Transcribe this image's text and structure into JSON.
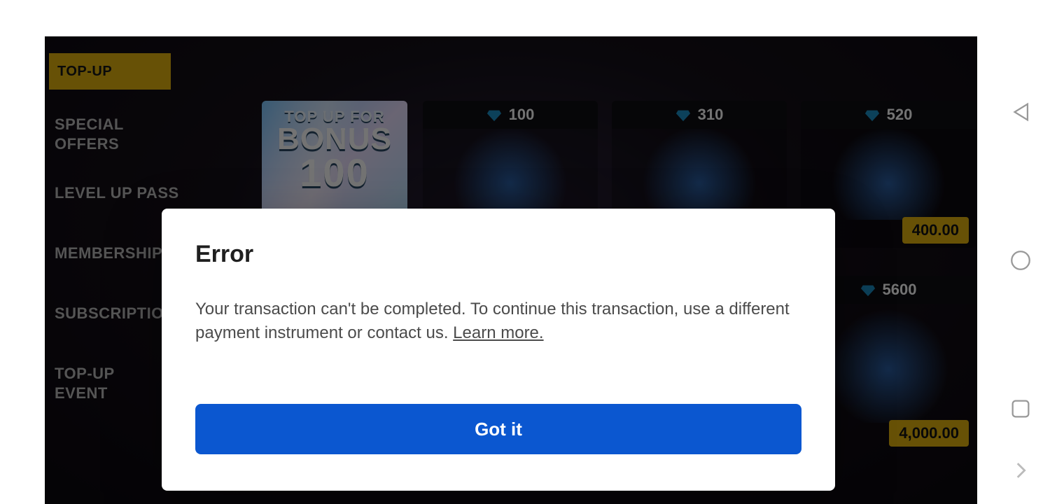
{
  "sidebar": {
    "active_tab": "TOP-UP",
    "items": [
      {
        "label": "SPECIAL OFFERS"
      },
      {
        "label": "LEVEL UP PASS"
      },
      {
        "label": "MEMBERSHIP"
      },
      {
        "label": "SUBSCRIPTION"
      },
      {
        "label": "TOP-UP EVENT"
      }
    ]
  },
  "banner": {
    "line1": "TOP UP FOR",
    "line2": "BONUS",
    "line3": "100"
  },
  "row1": [
    {
      "gems": "100",
      "price": ""
    },
    {
      "gems": "310",
      "price": ""
    },
    {
      "gems": "520",
      "price": "400.00"
    }
  ],
  "row2": [
    {
      "gems": "5600",
      "price": "4,000.00"
    }
  ],
  "modal": {
    "title": "Error",
    "message": "Your transaction can't be completed. To continue this transaction, use a different payment instrument or contact us. ",
    "learn_more": "Learn more.",
    "confirm": "Got it"
  }
}
